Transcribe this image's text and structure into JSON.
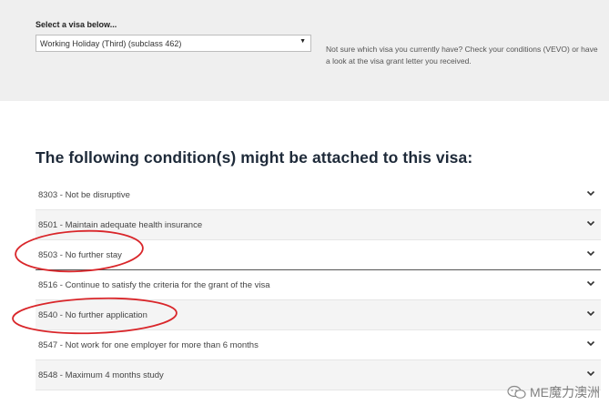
{
  "visa_selector": {
    "label": "Select a visa below...",
    "selected_value": "Working Holiday (Third) (subclass 462)",
    "help_text": "Not sure which visa you currently have? Check your conditions (VEVO) or have a look at the visa grant letter you received."
  },
  "conditions_section": {
    "title": "The following condition(s) might be attached to this visa:",
    "items": [
      {
        "label": "8303 - Not be disruptive"
      },
      {
        "label": "8501 - Maintain adequate health insurance"
      },
      {
        "label": "8503 - No further stay"
      },
      {
        "label": "8516 - Continue to satisfy the criteria for the grant of the visa"
      },
      {
        "label": "8540 - No further application"
      },
      {
        "label": "8547 - Not work for one employer for more than 6 months"
      },
      {
        "label": "8548 - Maximum 4 months study"
      }
    ]
  },
  "watermark": {
    "text": "ME魔力澳洲"
  },
  "colors": {
    "panel_background": "#efefef",
    "title": "#1e2a39",
    "highlight": "#d9262a"
  }
}
